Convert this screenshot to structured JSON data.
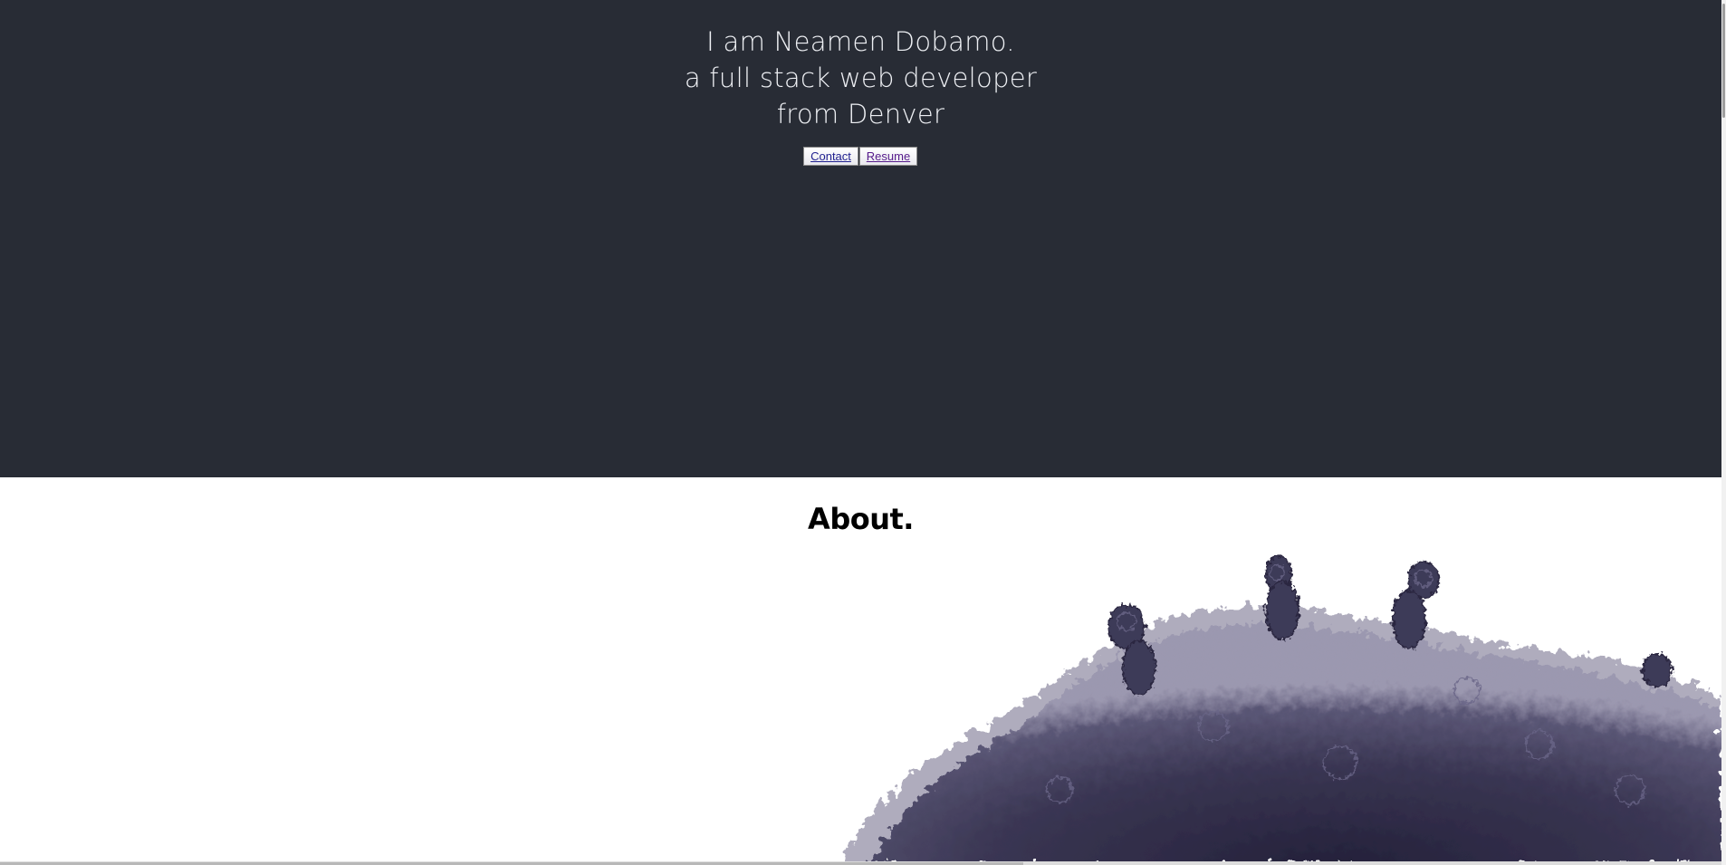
{
  "hero": {
    "line1": "I am Neamen Dobamo.",
    "line2": "a full stack web developer",
    "line3": "from Denver",
    "contact_label": "Contact",
    "resume_label": "Resume"
  },
  "about": {
    "heading": "About."
  },
  "colors": {
    "hero_bg": "#282c35",
    "hero_text": "#eef0f4",
    "hair": "#3c3852"
  }
}
